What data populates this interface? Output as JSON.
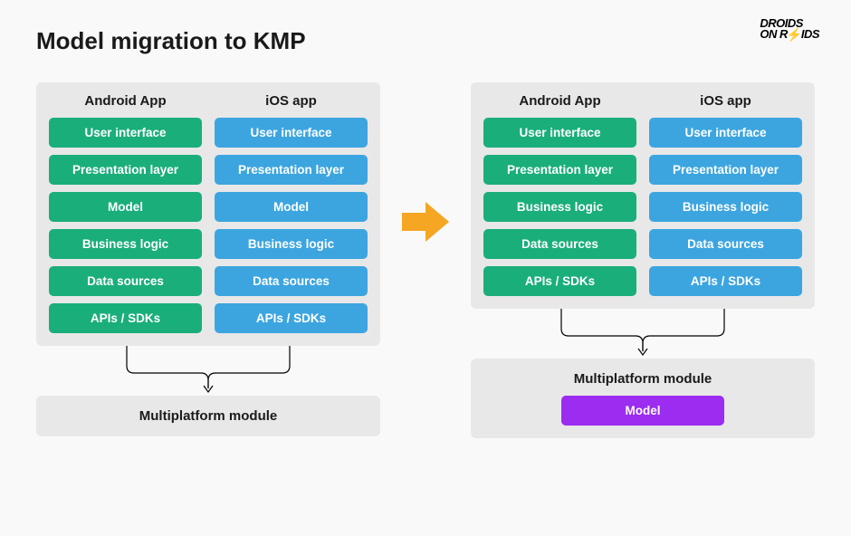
{
  "title": "Model migration to KMP",
  "logo": {
    "line1": "DROIDS",
    "line2_a": "ON R",
    "line2_b": "IDS"
  },
  "colors": {
    "green": "#1aae7a",
    "blue": "#3ca5e0",
    "purple": "#9b2cf0",
    "arrow": "#f5a623",
    "panel": "#e8e8e8"
  },
  "before": {
    "android": {
      "header": "Android App",
      "layers": [
        "User interface",
        "Presentation layer",
        "Model",
        "Business logic",
        "Data sources",
        "APIs / SDKs"
      ]
    },
    "ios": {
      "header": "iOS app",
      "layers": [
        "User interface",
        "Presentation layer",
        "Model",
        "Business logic",
        "Data sources",
        "APIs / SDKs"
      ]
    },
    "module": {
      "title": "Multiplatform module"
    }
  },
  "after": {
    "android": {
      "header": "Android App",
      "layers": [
        "User interface",
        "Presentation layer",
        "Business logic",
        "Data sources",
        "APIs / SDKs"
      ]
    },
    "ios": {
      "header": "iOS app",
      "layers": [
        "User interface",
        "Presentation layer",
        "Business logic",
        "Data sources",
        "APIs / SDKs"
      ]
    },
    "module": {
      "title": "Multiplatform module",
      "model": "Model"
    }
  }
}
